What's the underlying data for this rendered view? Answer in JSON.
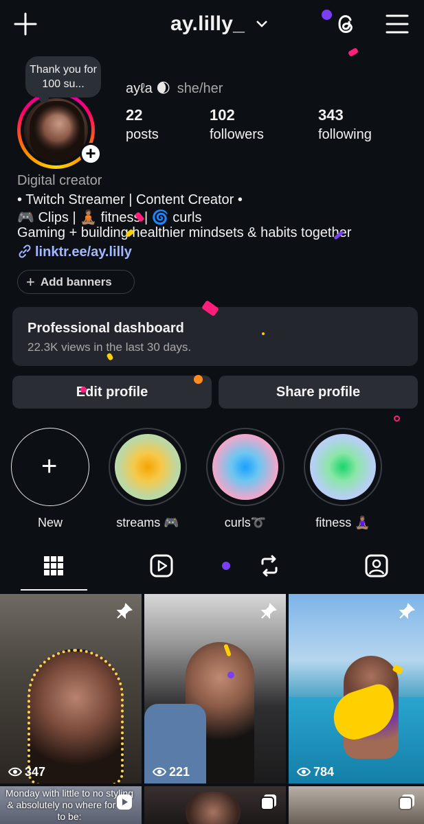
{
  "header": {
    "username": "ay.lilly_",
    "icons": [
      "plus-icon",
      "chevron-down-icon",
      "threads-icon",
      "hamburger-menu-icon"
    ]
  },
  "note": {
    "text": "Thank you for 100 su..."
  },
  "profile": {
    "display_name": "ayℓa 🌒",
    "pronouns": "she/her",
    "stats": [
      {
        "value": "22",
        "label": "posts"
      },
      {
        "value": "102",
        "label": "followers"
      },
      {
        "value": "343",
        "label": "following"
      }
    ],
    "category": "Digital creator",
    "bio_lines": [
      "• Twitch Streamer | Content Creator  •",
      "🎮 Clips | 🧘🏽 fitness | 🌀 curls",
      "Gaming + building healthier mindsets & habits together"
    ],
    "link": "linktr.ee/ay.lilly"
  },
  "add_banners": "Add banners",
  "dashboard": {
    "title": "Professional dashboard",
    "subtitle": "22.3K views in the last 30 days."
  },
  "buttons": {
    "edit": "Edit profile",
    "share": "Share profile"
  },
  "highlights": [
    {
      "label": "New"
    },
    {
      "label": "streams 🎮"
    },
    {
      "label": "curls➰"
    },
    {
      "label": "fitness 🧘🏽‍♀️"
    }
  ],
  "posts": [
    {
      "views": "347"
    },
    {
      "views": "221"
    },
    {
      "views": "784"
    },
    {
      "caption": "Monday with little to no styling & absolutely no where for me to be:"
    }
  ],
  "colors": {
    "background": "#0c0f14",
    "link": "#a4b8ff",
    "card": "#23262d",
    "button": "#2a2d34"
  }
}
